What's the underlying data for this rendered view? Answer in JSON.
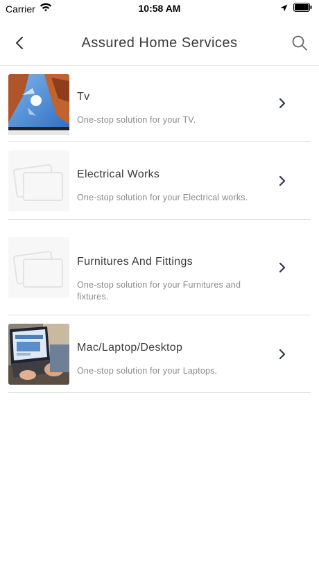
{
  "status_bar": {
    "carrier": "Carrier",
    "time": "10:58 AM"
  },
  "nav": {
    "title": "Assured Home Services",
    "back_icon": "chevron-left-icon",
    "search_icon": "search-icon"
  },
  "services": [
    {
      "title": "Tv",
      "subtitle": "One-stop solution for your TV.",
      "image": "tv-photo"
    },
    {
      "title": "Electrical Works",
      "subtitle": "One-stop solution for your Electrical works.",
      "image": "placeholder-image"
    },
    {
      "title": "Furnitures And Fittings",
      "subtitle": "One-stop solution for your Furnitures and fixtures.",
      "image": "placeholder-image"
    },
    {
      "title": "Mac/Laptop/Desktop",
      "subtitle": "One-stop solution for your Laptops.",
      "image": "laptop-photo"
    }
  ],
  "colors": {
    "title_text": "#3a3a3a",
    "subtitle_text": "#8a8a8a",
    "divider": "#dcdcdc",
    "chevron": "#2d3a4a"
  }
}
